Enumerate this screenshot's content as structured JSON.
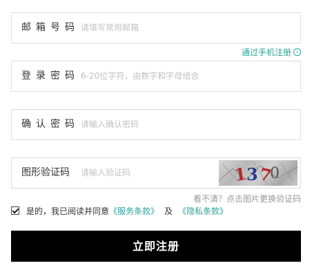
{
  "email": {
    "label": "邮箱号码",
    "placeholder": "请填写常用邮箱"
  },
  "switch_link": {
    "label": "通过手机注册",
    "icon": "chevron-right-circle-icon"
  },
  "password": {
    "label": "登录密码",
    "placeholder": "6-20位字符，由数字和字母组合"
  },
  "confirm": {
    "label": "确认密码",
    "placeholder": "请输入确认密码"
  },
  "captcha": {
    "label": "图形验证码",
    "placeholder": "请输入验证码",
    "image_text": "1370"
  },
  "refresh_hint": "看不清？点击图片更换验证码",
  "agreement": {
    "text": "是的，我已阅读并同意",
    "service_link": "《服务条款》",
    "and_text": "及",
    "privacy_link": "《隐私条款》"
  },
  "submit_label": "立即注册",
  "colors": {
    "accent": "#2ba39a",
    "button_bg": "#000000"
  }
}
